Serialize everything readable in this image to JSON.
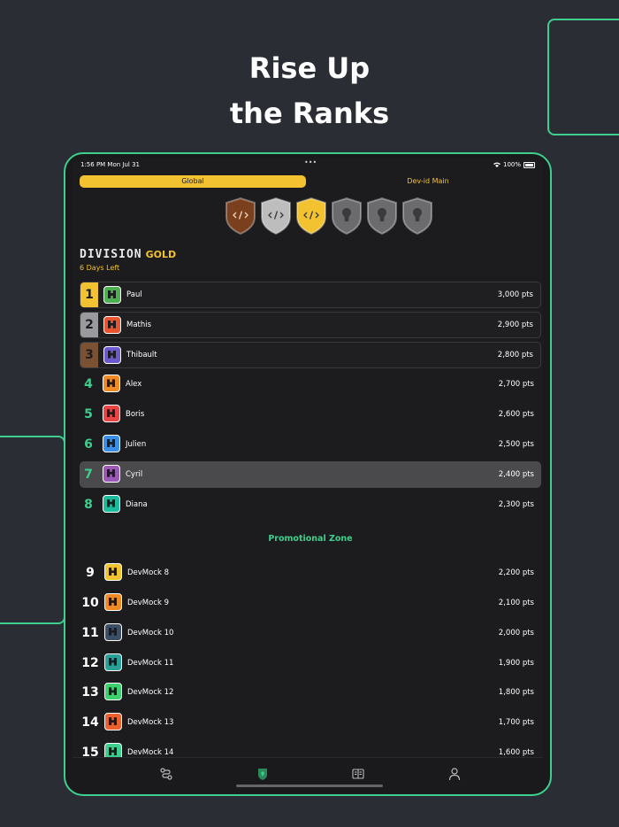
{
  "headline": {
    "line1": "Rise Up",
    "line2": "the Ranks"
  },
  "statusbar": {
    "time": "1:56 PM  Mon Jul 31",
    "battery": "100%",
    "dots": "•••"
  },
  "segments": {
    "global": "Global",
    "dev": "Dev-id Main"
  },
  "badges": [
    {
      "name": "bronze",
      "color": "#7a3f1d",
      "locked": false
    },
    {
      "name": "silver",
      "color": "#bdbdbd",
      "locked": false
    },
    {
      "name": "gold",
      "color": "#f2c230",
      "locked": false
    },
    {
      "name": "locked",
      "color": "#6b6b6d",
      "locked": true
    },
    {
      "name": "locked",
      "color": "#6b6b6d",
      "locked": true
    },
    {
      "name": "locked",
      "color": "#6b6b6d",
      "locked": true
    }
  ],
  "division": {
    "word": "DIVISION",
    "tier": "GOLD",
    "days_left": "6 Days Left"
  },
  "leaderboard": [
    {
      "rank": "1",
      "name": "Paul",
      "points": "3,000 pts",
      "avatar_color": "#4caf50"
    },
    {
      "rank": "2",
      "name": "Mathis",
      "points": "2,900 pts",
      "avatar_color": "#e8542f"
    },
    {
      "rank": "3",
      "name": "Thibault",
      "points": "2,800 pts",
      "avatar_color": "#6a5acd"
    },
    {
      "rank": "4",
      "name": "Alex",
      "points": "2,700 pts",
      "avatar_color": "#f08a24"
    },
    {
      "rank": "5",
      "name": "Boris",
      "points": "2,600 pts",
      "avatar_color": "#e84545"
    },
    {
      "rank": "6",
      "name": "Julien",
      "points": "2,500 pts",
      "avatar_color": "#3a8ee6"
    },
    {
      "rank": "7",
      "name": "Cyril",
      "points": "2,400 pts",
      "avatar_color": "#9b59b6"
    },
    {
      "rank": "8",
      "name": "Diana",
      "points": "2,300 pts",
      "avatar_color": "#1abc9c"
    }
  ],
  "promo_label": "Promotional Zone",
  "lower_board": [
    {
      "rank": "9",
      "name": "DevMock 8",
      "points": "2,200 pts",
      "avatar_color": "#f2c230"
    },
    {
      "rank": "10",
      "name": "DevMock 9",
      "points": "2,100 pts",
      "avatar_color": "#f08a24"
    },
    {
      "rank": "11",
      "name": "DevMock 10",
      "points": "2,000 pts",
      "avatar_color": "#3d4f66"
    },
    {
      "rank": "12",
      "name": "DevMock 11",
      "points": "1,900 pts",
      "avatar_color": "#2aa198"
    },
    {
      "rank": "13",
      "name": "DevMock 12",
      "points": "1,800 pts",
      "avatar_color": "#3ecf6e"
    },
    {
      "rank": "14",
      "name": "DevMock 13",
      "points": "1,700 pts",
      "avatar_color": "#e8612f"
    },
    {
      "rank": "15",
      "name": "DevMock 14",
      "points": "1,600 pts",
      "avatar_color": "#3ecf8e"
    }
  ],
  "tabbar": [
    {
      "name": "tab-challenges",
      "icon": "path-icon"
    },
    {
      "name": "tab-leaderboard",
      "icon": "trophy-icon"
    },
    {
      "name": "tab-library",
      "icon": "book-icon"
    },
    {
      "name": "tab-profile",
      "icon": "person-icon"
    }
  ],
  "colors": {
    "accent": "#3ecf8e",
    "gold": "#f2c230",
    "background": "#2a2d33"
  }
}
